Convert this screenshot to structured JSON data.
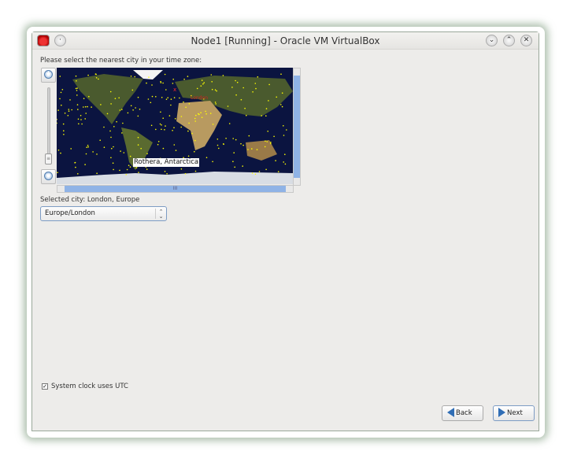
{
  "window": {
    "title": "Node1 [Running] - Oracle VM VirtualBox"
  },
  "prompt": "Please select the nearest city in your time zone:",
  "map": {
    "hover_city": "Rothera, Antarctica",
    "selected_marker": "London",
    "marker_color": "#ffff00",
    "selected_color": "#ff2a2a"
  },
  "selected_city_label": "Selected city: London, Europe",
  "timezone_select": {
    "value": "Europe/London"
  },
  "utc_checkbox": {
    "label": "System clock uses UTC",
    "checked": true
  },
  "buttons": {
    "back": "Back",
    "next": "Next"
  }
}
